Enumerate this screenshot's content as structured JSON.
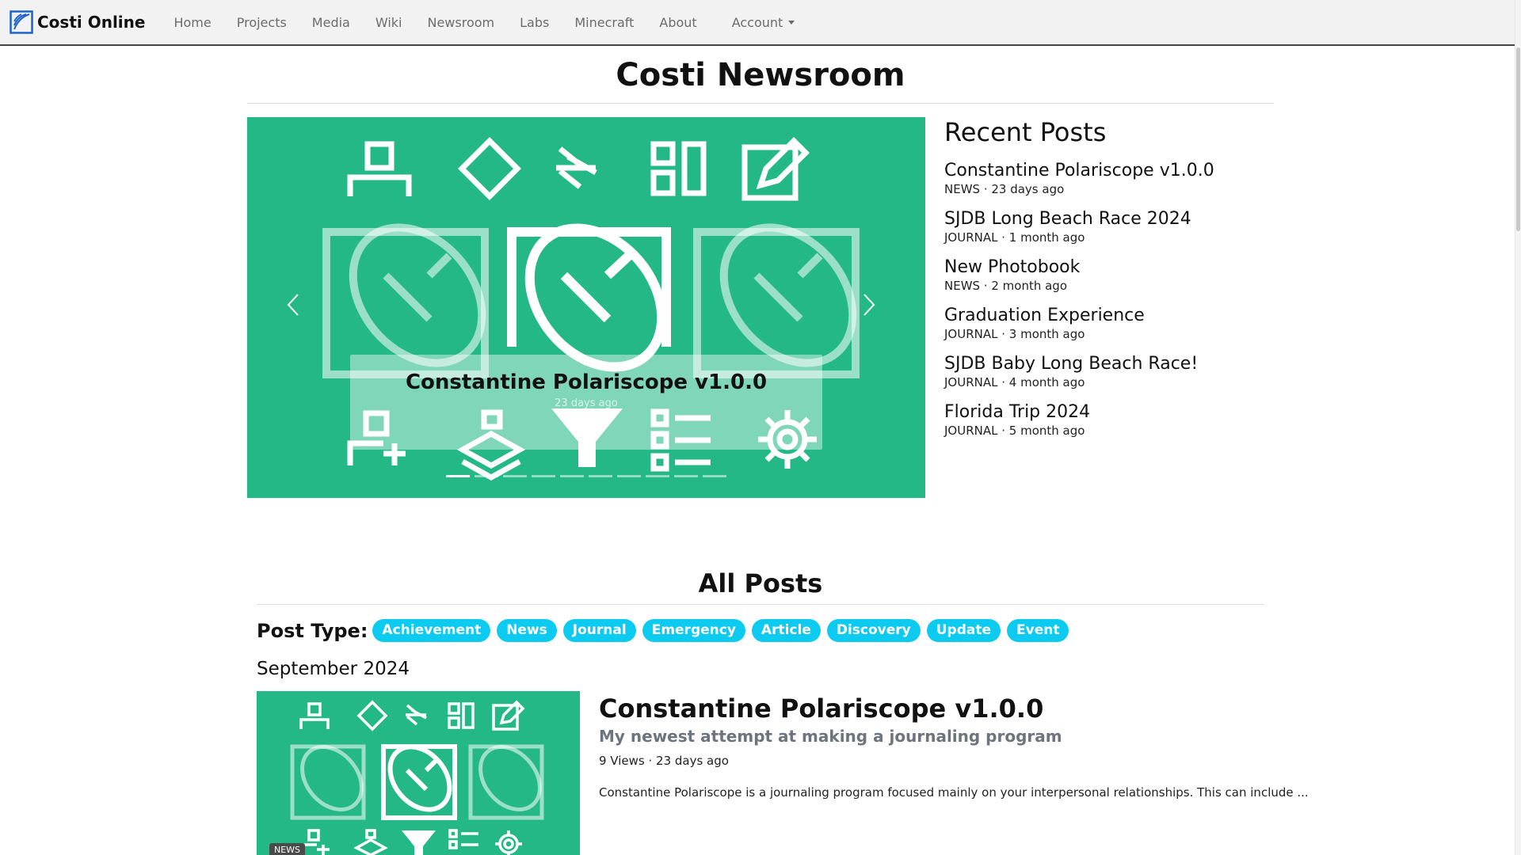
{
  "nav": {
    "brand": "Costi Online",
    "items": [
      "Home",
      "Projects",
      "Media",
      "Wiki",
      "Newsroom",
      "Labs",
      "Minecraft",
      "About"
    ],
    "account": "Account"
  },
  "page": {
    "title": "Costi Newsroom"
  },
  "carousel": {
    "caption_title": "Constantine Polariscope v1.0.0",
    "caption_sub": "23 days ago",
    "slide_count": 10,
    "active_index": 0
  },
  "recent": {
    "heading": "Recent Posts",
    "items": [
      {
        "title": "Constantine Polariscope v1.0.0",
        "meta": "NEWS · 23 days ago"
      },
      {
        "title": "SJDB Long Beach Race 2024",
        "meta": "JOURNAL · 1 month ago"
      },
      {
        "title": "New Photobook",
        "meta": "NEWS · 2 month ago"
      },
      {
        "title": "Graduation Experience",
        "meta": "JOURNAL · 3 month ago"
      },
      {
        "title": "SJDB Baby Long Beach Race!",
        "meta": "JOURNAL · 4 month ago"
      },
      {
        "title": "Florida Trip 2024",
        "meta": "JOURNAL · 5 month ago"
      }
    ]
  },
  "all_posts": {
    "title": "All Posts",
    "filter_label": "Post Type:",
    "filters": [
      "Achievement",
      "News",
      "Journal",
      "Emergency",
      "Article",
      "Discovery",
      "Update",
      "Event"
    ],
    "month": "September 2024",
    "posts": [
      {
        "badge": "NEWS",
        "title": "Constantine Polariscope v1.0.0",
        "subtitle": "My newest attempt at making a journaling program",
        "meta": "9 Views · 23 days ago",
        "excerpt": "Constantine Polariscope is a journaling program focused mainly on your interpersonal relationships. This can include ..."
      }
    ]
  },
  "colors": {
    "accent_green": "#23b886",
    "pill_cyan": "#0dcaf0",
    "muted": "#6c757d"
  }
}
